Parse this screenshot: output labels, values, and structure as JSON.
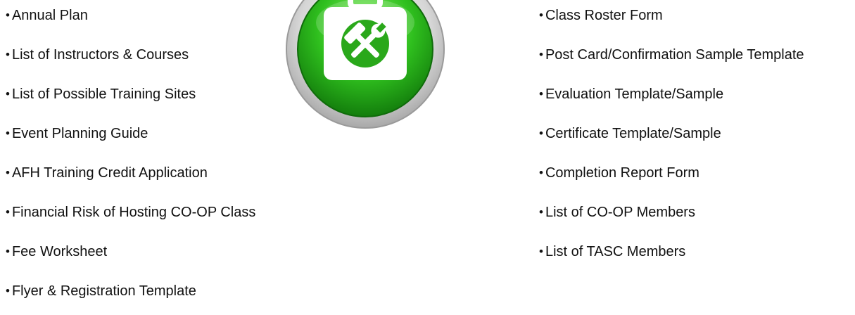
{
  "left_list": {
    "items": [
      "Annual Plan",
      "List of Instructors & Courses",
      "List of Possible Training Sites",
      "Event Planning Guide",
      "AFH Training Credit Application",
      "Financial Risk of Hosting CO-OP Class",
      "Fee Worksheet",
      "Flyer & Registration Template"
    ]
  },
  "right_list": {
    "items": [
      "Class Roster Form",
      "Post Card/Confirmation Sample Template",
      "Evaluation Template/Sample",
      "Certificate Template/Sample",
      "Completion Report Form",
      "List of CO-OP Members",
      "List of TASC Members"
    ]
  },
  "bullet": "•",
  "emblem": {
    "icon": "toolbox-icon",
    "colors": {
      "green": "#2fae1f",
      "green_light": "#7ff05a",
      "ring": "#c8c8c8"
    }
  }
}
